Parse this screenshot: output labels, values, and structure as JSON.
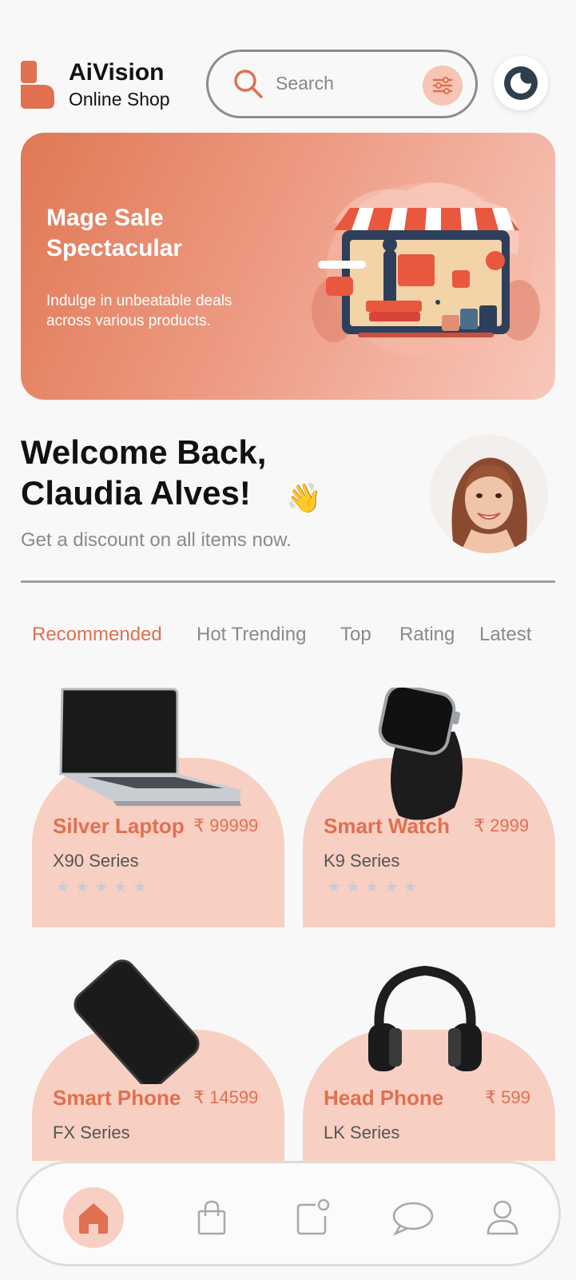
{
  "brand": {
    "name": "AiVision",
    "subtitle": "Online Shop"
  },
  "search": {
    "placeholder": "Search"
  },
  "banner": {
    "title": "Mage Sale Spectacular",
    "subtitle": "Indulge in unbeatable deals across various products."
  },
  "welcome": {
    "line1": "Welcome Back,",
    "line2": "Claudia Alves!",
    "emoji": "👋",
    "subtitle": "Get a discount on all items now."
  },
  "tabs": [
    {
      "label": "Recommended",
      "active": true
    },
    {
      "label": "Hot Trending",
      "active": false
    },
    {
      "label": "Top",
      "active": false
    },
    {
      "label": "Rating",
      "active": false
    },
    {
      "label": "Latest",
      "active": false
    }
  ],
  "products": [
    {
      "name": "Silver Laptop",
      "price": "₹ 99999",
      "series": "X90 Series",
      "icon": "laptop-icon"
    },
    {
      "name": "Smart Watch",
      "price": "₹ 2999",
      "series": "K9 Series",
      "icon": "watch-icon"
    },
    {
      "name": "Smart Phone",
      "price": "₹ 14599",
      "series": "FX Series",
      "icon": "phone-icon"
    },
    {
      "name": "Head Phone",
      "price": "₹ 599",
      "series": "LK Series",
      "icon": "headphone-icon"
    }
  ],
  "nav": [
    {
      "icon": "home-icon",
      "active": true
    },
    {
      "icon": "bag-icon",
      "active": false
    },
    {
      "icon": "notification-icon",
      "active": false
    },
    {
      "icon": "chat-icon",
      "active": false
    },
    {
      "icon": "profile-icon",
      "active": false
    }
  ],
  "colors": {
    "accent": "#e07050",
    "card": "#f8cfc3",
    "banner_start": "#e07855",
    "banner_end": "#f7c8bb"
  }
}
